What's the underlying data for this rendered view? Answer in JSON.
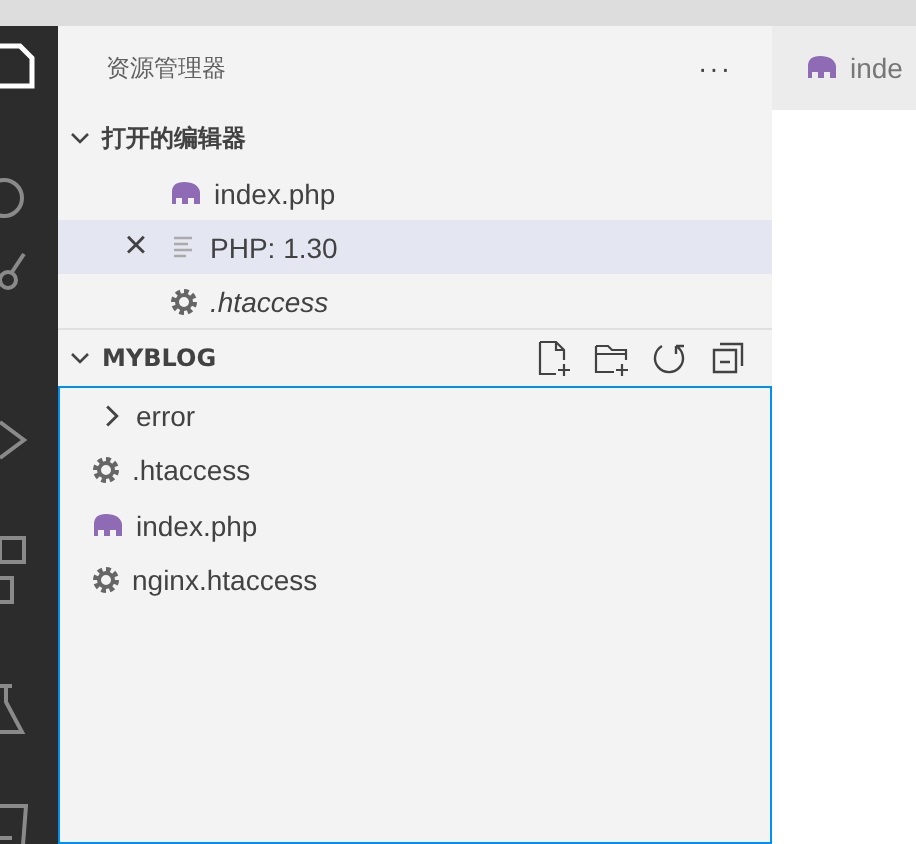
{
  "explorer": {
    "title": "资源管理器",
    "more": "···"
  },
  "open_editors": {
    "title": "打开的编辑器",
    "expanded": true,
    "items": [
      {
        "name": "index.php",
        "kind": "php",
        "selected": false,
        "preview": false
      },
      {
        "name": "PHP: 1.30",
        "kind": "text",
        "selected": true,
        "preview": false,
        "close": "×"
      },
      {
        "name": ".htaccess",
        "kind": "gear",
        "selected": false,
        "preview": true
      }
    ]
  },
  "folder": {
    "title": "MYBLOG",
    "expanded": true,
    "focused": true,
    "items": [
      {
        "name": "error",
        "kind": "folder",
        "expanded": false
      },
      {
        "name": ".htaccess",
        "kind": "gear"
      },
      {
        "name": "index.php",
        "kind": "php"
      },
      {
        "name": "nginx.htaccess",
        "kind": "gear"
      }
    ]
  },
  "editor_tab": {
    "label": "inde"
  }
}
